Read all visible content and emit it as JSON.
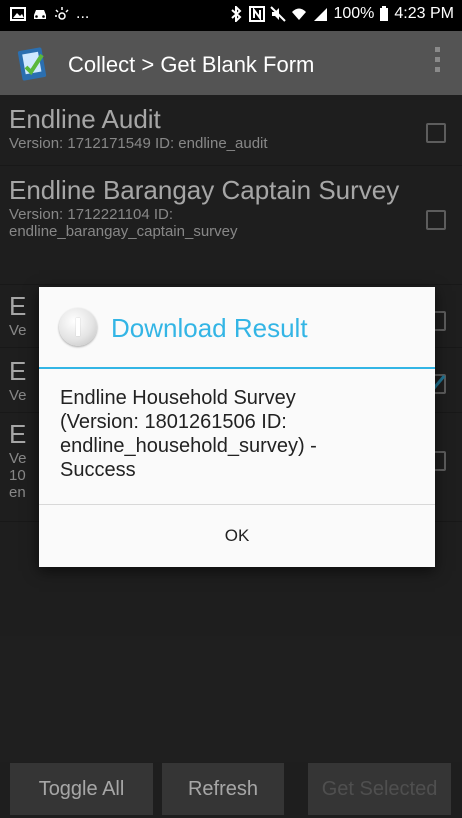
{
  "status_bar": {
    "dots": "...",
    "battery": "100%",
    "time": "4:23 PM",
    "icons": [
      "image-icon",
      "car-icon",
      "beam-icon",
      "bluetooth-icon",
      "nfc-icon",
      "mute-icon",
      "wifi-icon",
      "signal-icon",
      "battery-icon"
    ]
  },
  "action_bar": {
    "title": "Collect > Get Blank Form",
    "icon": "collect-app-icon"
  },
  "forms": [
    {
      "title": "Endline Audit",
      "sub": "Version: 1712171549 ID: endline_audit",
      "checked": false
    },
    {
      "title": "Endline Barangay Captain Survey",
      "sub": "Version: 1712221104 ID: endline_barangay_captain_survey",
      "checked": false
    },
    {
      "title": "E",
      "sub": "Ve",
      "checked": false
    },
    {
      "title": "E",
      "sub": "Ve",
      "checked": true
    },
    {
      "title": "E",
      "sub": "Ve\n10\nen",
      "checked": false
    }
  ],
  "buttons": {
    "toggle_all": "Toggle All",
    "refresh": "Refresh",
    "get_selected": "Get Selected"
  },
  "dialog": {
    "title": "Download Result",
    "message": "Endline Household Survey (Version: 1801261506 ID: endline_household_survey) - Success",
    "ok": "OK",
    "accent": "#33b5e5"
  }
}
